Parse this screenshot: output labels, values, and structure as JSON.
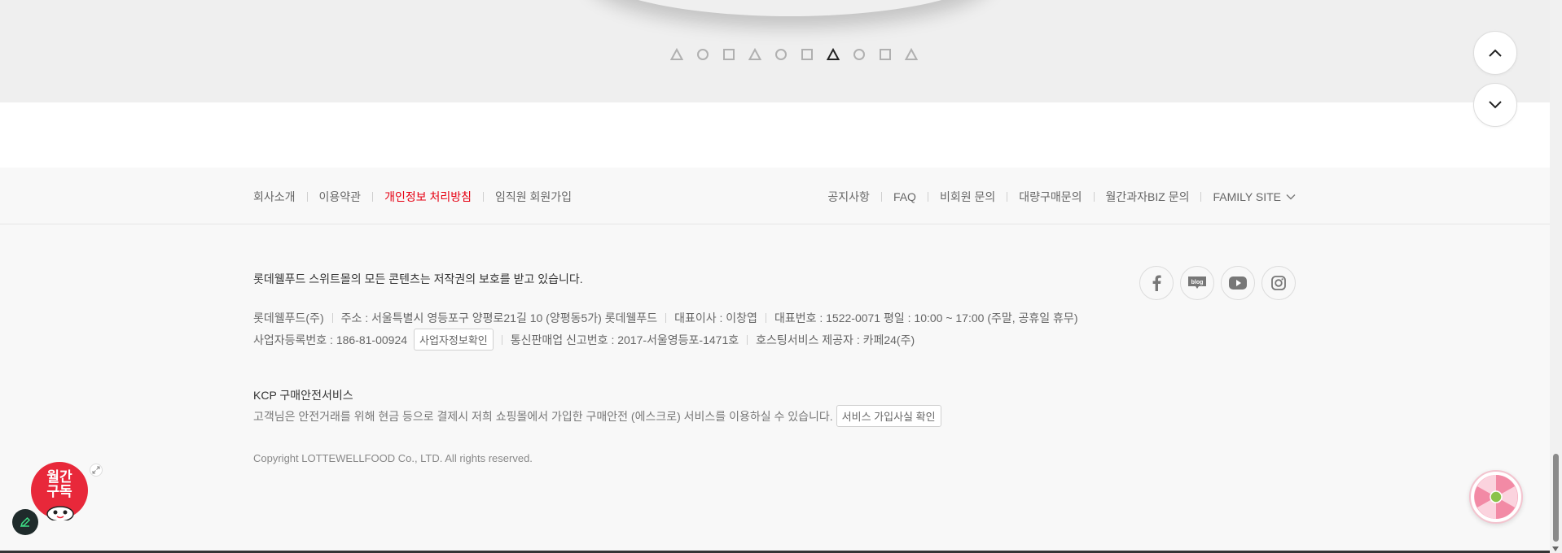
{
  "pager": {
    "items": [
      {
        "shape": "triangle",
        "active": false
      },
      {
        "shape": "circle",
        "active": false
      },
      {
        "shape": "square",
        "active": false
      },
      {
        "shape": "triangle",
        "active": false
      },
      {
        "shape": "circle",
        "active": false
      },
      {
        "shape": "square",
        "active": false
      },
      {
        "shape": "triangle",
        "active": true
      },
      {
        "shape": "circle",
        "active": false
      },
      {
        "shape": "square",
        "active": false
      },
      {
        "shape": "triangle",
        "active": false
      }
    ]
  },
  "scroll": {
    "up_icon": "chevron-up-icon",
    "down_icon": "chevron-down-icon"
  },
  "footer_nav": {
    "left": [
      {
        "label": "회사소개"
      },
      {
        "label": "이용약관"
      },
      {
        "label": "개인정보 처리방침",
        "highlight": "#e60012"
      },
      {
        "label": "임직원 회원가입"
      }
    ],
    "right": [
      {
        "label": "공지사항"
      },
      {
        "label": "FAQ"
      },
      {
        "label": "비회원 문의"
      },
      {
        "label": "대량구매문의"
      },
      {
        "label": "월간과자BIZ 문의"
      }
    ],
    "family_site": "FAMILY SITE"
  },
  "company": {
    "copyright_notice": "롯데웰푸드 스위트몰의 모든 콘텐츠는 저작권의 보호를 받고 있습니다.",
    "name": "롯데웰푸드(주)",
    "address": "주소 : 서울특별시 영등포구 양평로21길 10 (양평동5가) 롯데웰푸드",
    "ceo": "대표이사 : 이창엽",
    "phone": "대표번호 : 1522-0071 평일 : 10:00 ~ 17:00 (주말, 공휴일 휴무)",
    "biz_no": "사업자등록번호 : 186-81-00924",
    "biz_check_btn": "사업자정보확인",
    "ecommerce_no": "통신판매업 신고번호 : 2017-서울영등포-1471호",
    "hosting": "호스팅서비스 제공자 : 카페24(주)"
  },
  "kcp": {
    "title": "KCP 구매안전서비스",
    "desc": "고객님은 안전거래를 위해 현금 등으로 결제시 저희 쇼핑몰에서 가입한 구매안전 (에스크로) 서비스를 이용하실 수 있습니다.",
    "btn": "서비스 가입사실 확인"
  },
  "copyright": "Copyright LOTTEWELLFOOD Co., LTD. All rights reserved.",
  "social": [
    {
      "icon": "facebook-icon"
    },
    {
      "icon": "blog-icon",
      "text": "blog"
    },
    {
      "icon": "youtube-icon"
    },
    {
      "icon": "instagram-icon"
    }
  ],
  "promo": {
    "line1": "월간",
    "line2": "구독"
  },
  "colors": {
    "accent_red": "#e60012",
    "promo_red": "#e8283a"
  }
}
